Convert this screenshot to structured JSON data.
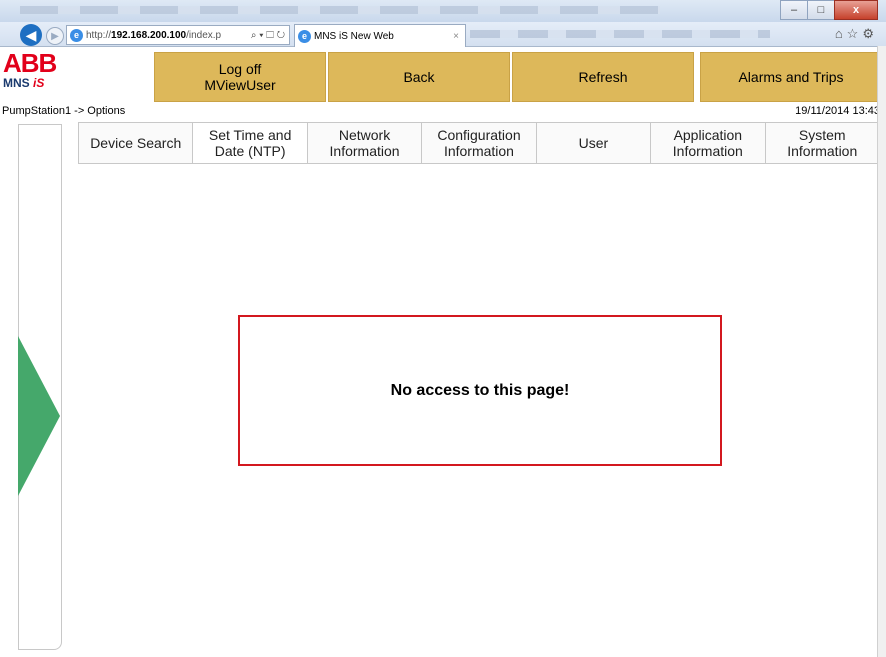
{
  "browser": {
    "url_prefix": "http://",
    "url_host": "192.168.200.100",
    "url_path": "/index.p",
    "addr_tools": "⌕ ▾ ☐ ↻",
    "tab_title": "MNS iS New Web",
    "tab_close": "×",
    "window_minimize": "–",
    "window_maximize": "□",
    "window_close": "x",
    "ie_tools": "⌂☆⚙"
  },
  "logo": {
    "brand": "ABB",
    "product": "MNS",
    "product_suffix": "iS"
  },
  "header_buttons": {
    "logoff_line1": "Log off",
    "logoff_line2": "MViewUser",
    "back": "Back",
    "refresh": "Refresh",
    "alarms": "Alarms and Trips"
  },
  "breadcrumb": "PumpStation1 -> Options",
  "datetime": "19/11/2014 13:43",
  "tabs": [
    {
      "line1": "Device Search",
      "line2": ""
    },
    {
      "line1": "Set Time and",
      "line2": "Date (NTP)"
    },
    {
      "line1": "Network",
      "line2": "Information"
    },
    {
      "line1": "Configuration",
      "line2": "Information"
    },
    {
      "line1": "User",
      "line2": ""
    },
    {
      "line1": "Application",
      "line2": "Information"
    },
    {
      "line1": "System",
      "line2": "Information"
    }
  ],
  "message": "No access to this page!",
  "colors": {
    "button": "#ddb85a",
    "arrow": "#45a86b",
    "error_border": "#d3181f",
    "brand_red": "#e2001a"
  }
}
